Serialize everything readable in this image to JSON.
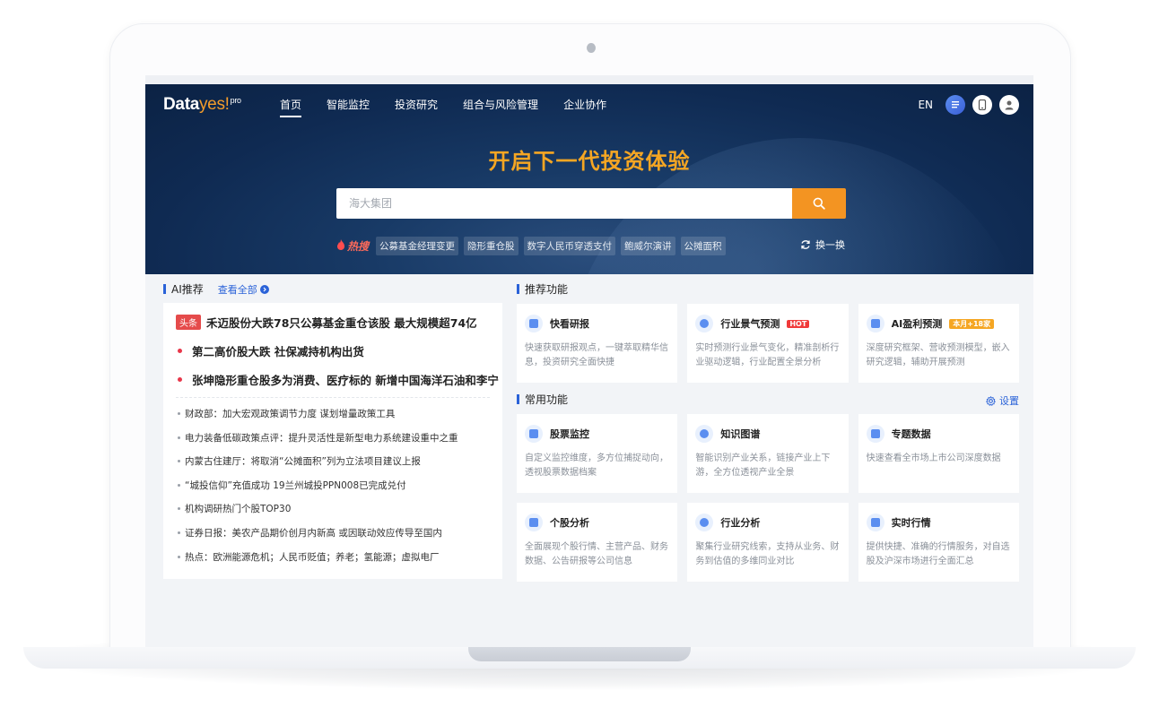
{
  "brand": {
    "name_prefix": "Data",
    "name_suffix": "yes!",
    "sup": "pro"
  },
  "nav": [
    "首页",
    "智能监控",
    "投资研究",
    "组合与风险管理",
    "企业协作"
  ],
  "top_right": {
    "lang": "EN"
  },
  "hero": {
    "title": "开启下一代投资体验"
  },
  "search": {
    "placeholder": "海大集团"
  },
  "hot": {
    "label": "热搜",
    "tags": [
      "公募基金经理变更",
      "隐形重仓股",
      "数字人民币穿透支付",
      "鲍威尔演讲",
      "公摊面积"
    ],
    "refresh": "换一换"
  },
  "ai": {
    "title": "AI推荐",
    "view_all": "查看全部",
    "badge": "头条",
    "headline": "禾迈股份大跌78只公募基金重仓该股 最大规模超74亿",
    "highlights": [
      "第二高价股大跌 社保减持机构出货",
      "张坤隐形重仓股多为消费、医疗标的 新增中国海洋石油和李宁"
    ],
    "news": [
      "财政部：加大宏观政策调节力度 谋划增量政策工具",
      "电力装备低碳政策点评：提升灵活性是新型电力系统建设重中之重",
      "内蒙古住建厅：将取消“公摊面积”列为立法项目建议上报",
      "“城投信仰”充值成功 19兰州城投PPN008已完成兑付",
      "机构调研热门个股TOP30",
      "证券日报：美农产品期价创月内新高 或因联动效应传导至国内",
      "热点：欧洲能源危机；人民币贬值；养老；氢能源；虚拟电厂"
    ]
  },
  "recommended": {
    "title": "推荐功能",
    "cards": [
      {
        "title": "快看研报",
        "desc": "快速获取研报观点，一键萃取精华信息，投资研究全面快捷",
        "icon": "doc-icon"
      },
      {
        "title": "行业景气预测",
        "tag": "HOT",
        "desc": "实时预测行业景气变化，精准剖析行业驱动逻辑，行业配置全景分析",
        "icon": "gauge-icon"
      },
      {
        "title": "AI盈利预测",
        "tag": "本月+18家",
        "desc": "深度研究框架、营收预测模型，嵌入研究逻辑，辅助开展预测",
        "icon": "chart-icon"
      }
    ]
  },
  "common": {
    "title": "常用功能",
    "settings": "设置",
    "cards": [
      {
        "title": "股票监控",
        "desc": "自定义监控维度，多方位捕捉动向，透视股票数据档案",
        "icon": "shield-icon"
      },
      {
        "title": "知识图谱",
        "desc": "智能识别产业关系，链接产业上下游，全方位透视产业全景",
        "icon": "graph-icon"
      },
      {
        "title": "专题数据",
        "desc": "快速查看全市场上市公司深度数据",
        "icon": "database-icon"
      },
      {
        "title": "个股分析",
        "desc": "全面展现个股行情、主营产品、财务数据、公告研报等公司信息",
        "icon": "bar-chart-icon"
      },
      {
        "title": "行业分析",
        "desc": "聚集行业研究线索，支持从业务、财务到估值的多维同业对比",
        "icon": "industry-icon"
      },
      {
        "title": "实时行情",
        "desc": "提供快捷、准确的行情服务，对自选股及沪深市场进行全面汇总",
        "icon": "trend-icon"
      }
    ]
  }
}
